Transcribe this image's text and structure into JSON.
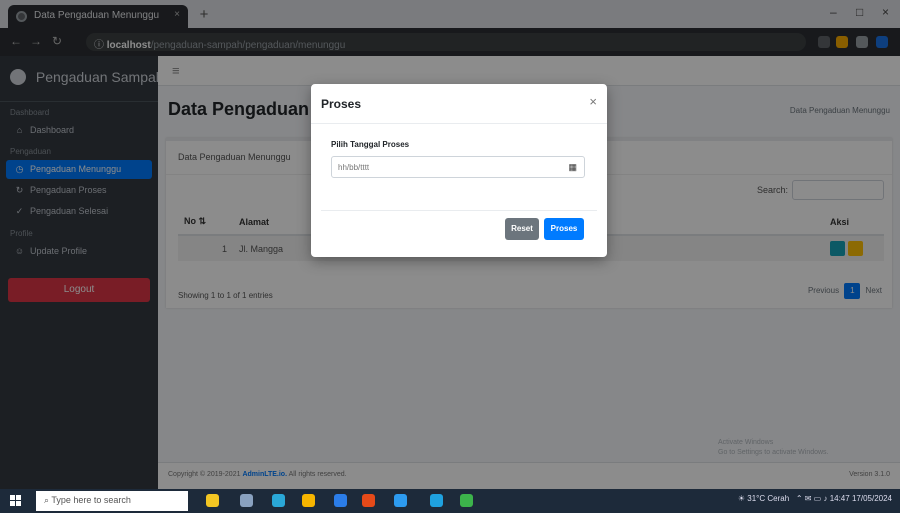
{
  "browser": {
    "tab_title": "Data Pengaduan Menunggu",
    "tab_close": "×",
    "new_tab": "+",
    "url_host": "localhost",
    "url_path": "/pengaduan-sampah/pengaduan/menunggu",
    "window_minimize": "–",
    "window_maximize": "□",
    "window_close": "×"
  },
  "sidebar": {
    "brand": "Pengaduan Sampah",
    "sections": [
      {
        "header": "Dashboard",
        "items": [
          {
            "label": "Dashboard",
            "icon": "home-icon",
            "glyph": "⌂"
          }
        ]
      },
      {
        "header": "Pengaduan",
        "items": [
          {
            "label": "Pengaduan Menunggu",
            "icon": "clock-icon",
            "glyph": "◷",
            "active": true
          },
          {
            "label": "Pengaduan Proses",
            "icon": "refresh-icon",
            "glyph": "↻"
          },
          {
            "label": "Pengaduan Selesai",
            "icon": "check-icon",
            "glyph": "✓"
          }
        ]
      },
      {
        "header": "Profile",
        "items": [
          {
            "label": "Update Profile",
            "icon": "users-icon",
            "glyph": "☺"
          }
        ]
      }
    ],
    "logout": "Logout"
  },
  "topnav": {
    "menu_icon": "≡"
  },
  "page": {
    "title": "Data Pengaduan Menunggu",
    "breadcrumb": "Data Pengaduan Menunggu"
  },
  "card": {
    "header": "Data Pengaduan Menunggu",
    "search_label": "Search:",
    "columns": [
      "No",
      "Alamat",
      "",
      "",
      "Aksi"
    ],
    "rows": [
      {
        "no": "1",
        "alamat": "Jl. Mangga"
      }
    ],
    "info": "Showing 1 to 1 of 1 entries",
    "prev": "Previous",
    "page": "1",
    "next": "Next"
  },
  "footer": {
    "copyright": "Copyright © 2019-2021 ",
    "brand": "AdminLTE.io.",
    "rights": " All rights reserved.",
    "version": "Version 3.1.0"
  },
  "watermark": {
    "line1": "Activate Windows",
    "line2": "Go to Settings to activate Windows."
  },
  "modal": {
    "title": "Proses",
    "close": "×",
    "field_label": "Pilih Tanggal Proses",
    "date_placeholder": "hh/bb/tttt",
    "calendar_icon": "▦",
    "reset_label": "Reset",
    "proses_label": "Proses"
  },
  "taskbar": {
    "search_placeholder": "Type here to search",
    "search_icon": "⌕",
    "weather": "31°C Cerah",
    "time": "14:47",
    "date": "17/05/2024"
  },
  "colors": {
    "accent": "#007bff",
    "danger": "#dc3545",
    "sidebar": "#343a40"
  }
}
